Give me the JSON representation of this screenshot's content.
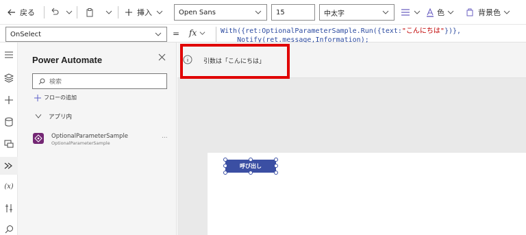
{
  "toolbar": {
    "back_label": "戻る",
    "insert_label": "挿入",
    "font_family": "Open Sans",
    "font_size": "15",
    "font_weight": "中太字",
    "color_label": "色",
    "fill_label": "背景色"
  },
  "formula_bar": {
    "property": "OnSelect",
    "fx_label": "fx",
    "line1_a": "With({ret:OptionalParameterSample.Run({text:",
    "line1_str": "\"こんにちは\"",
    "line1_b": "})},",
    "line2": "    Notify(ret.message,Information);"
  },
  "panel": {
    "title": "Power Automate",
    "search_placeholder": "検索",
    "add_flow_label": "フローの追加",
    "group_label": "アプリ内",
    "flow_name": "OptionalParameterSample",
    "flow_subtitle": "OptionalParameterSample",
    "flow_more": "..."
  },
  "notification": {
    "message": "引数は「こんにちは」"
  },
  "canvas": {
    "button_label": "呼び出し"
  },
  "colors": {
    "highlight": "#e00000",
    "button": "#3b4fa3",
    "flow_icon": "#742774"
  }
}
